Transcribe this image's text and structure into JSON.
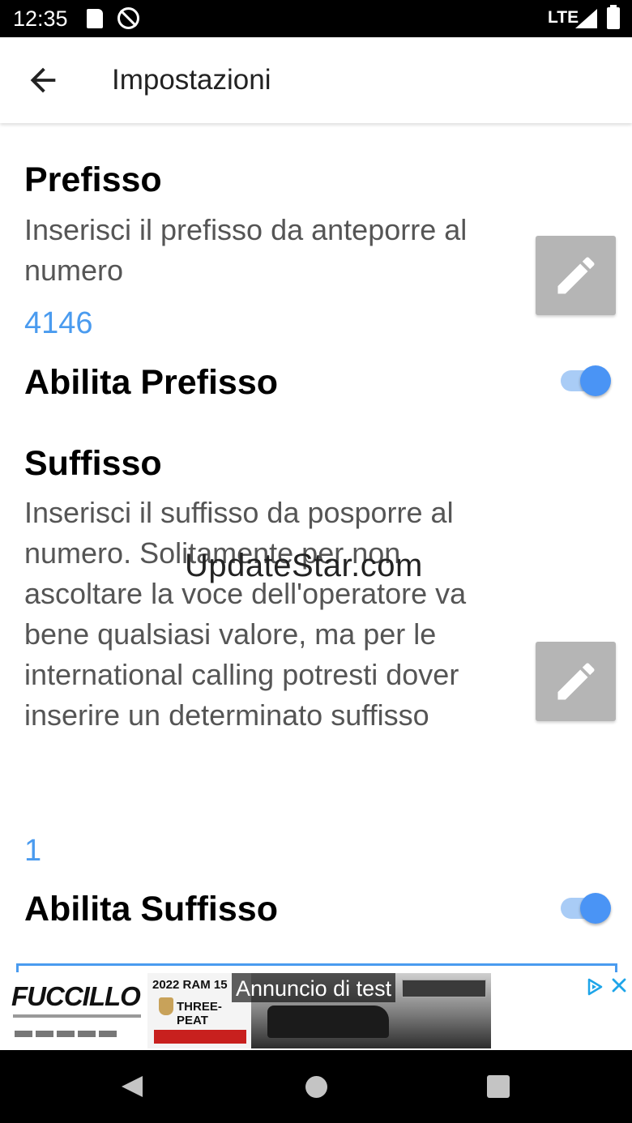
{
  "status_bar": {
    "time": "12:35",
    "network": "LTE",
    "icons": [
      "sd-card-icon",
      "do-not-disturb-icon",
      "signal-icon",
      "battery-icon"
    ]
  },
  "app_bar": {
    "title": "Impostazioni",
    "back_icon": "arrow-left-icon"
  },
  "settings": {
    "prefix": {
      "title": "Prefisso",
      "summary": "Inserisci il prefisso da anteporre al numero",
      "value": "4146",
      "edit_icon": "pencil-icon"
    },
    "enable_prefix": {
      "title": "Abilita Prefisso",
      "checked": true
    },
    "suffix": {
      "title": "Suffisso",
      "summary": "Inserisci il suffisso da posporre al numero. Solitamente per non ascoltare la voce dell'operatore va bene qualsiasi valore, ma per le international calling potresti dover inserire un determinato suffisso",
      "value": "1",
      "edit_icon": "pencil-icon"
    },
    "enable_suffix": {
      "title": "Abilita Suffisso",
      "checked": true
    }
  },
  "watermark": "UpdateStar.com",
  "ad": {
    "label": "Annuncio di test",
    "logo_text": "FUCCILLO",
    "headline": "2022 RAM 15",
    "badge": "THREE-PEAT",
    "adchoices_icon": "adchoices-icon",
    "close_icon": "close-icon"
  },
  "nav_bar": {
    "icons": [
      "back-triangle-icon",
      "home-circle-icon",
      "recents-square-icon"
    ]
  },
  "colors": {
    "accent": "#4a9bef",
    "switch_thumb": "#4a94f5",
    "switch_track": "#a9ccf6",
    "edit_button_bg": "#b5b5b5",
    "status_bar_bg": "#000000",
    "nav_bar_bg": "#000000"
  }
}
